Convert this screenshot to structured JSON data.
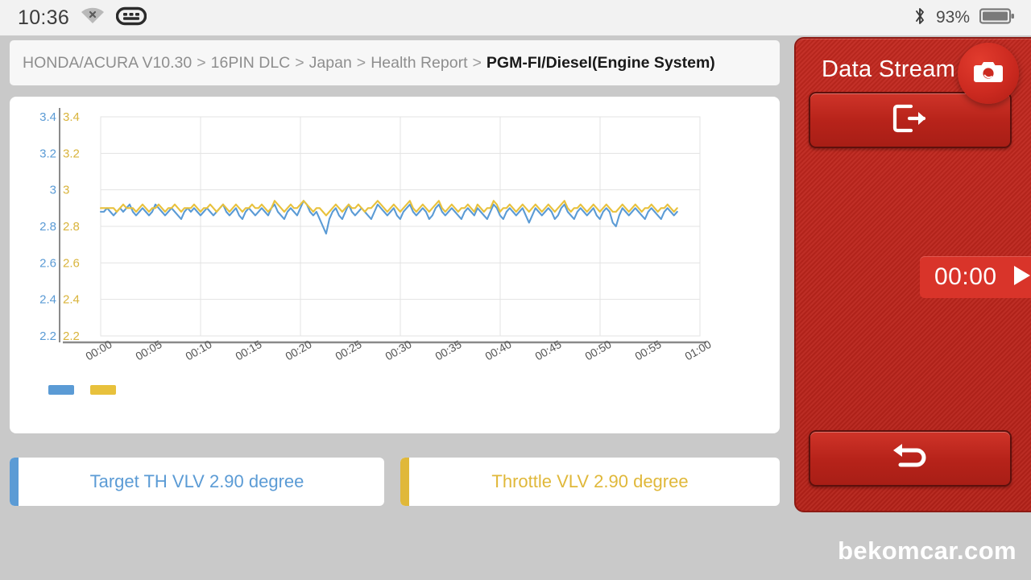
{
  "statusbar": {
    "time": "10:36",
    "battery_percent": "93%",
    "wifi_icon": "wifi-off-icon",
    "keyboard_icon": "keyboard-icon",
    "bluetooth_icon": "bluetooth-icon",
    "battery_icon": "battery-icon"
  },
  "breadcrumb": {
    "items": [
      {
        "label": "HONDA/ACURA V10.30",
        "active": false
      },
      {
        "label": "16PIN DLC",
        "active": false
      },
      {
        "label": "Japan",
        "active": false
      },
      {
        "label": "Health Report",
        "active": false
      },
      {
        "label": "PGM-FI/Diesel(Engine System)",
        "active": true
      }
    ],
    "separator": ">"
  },
  "side_panel": {
    "title": "Data Stream",
    "exit_button_icon": "exit-icon",
    "back_button_icon": "back-arrow-icon",
    "camera_button_icon": "camera-icon",
    "timer": {
      "value": "00:00",
      "play_icon": "play-icon"
    }
  },
  "value_cards": [
    {
      "label": "Target TH VLV 2.90 degree",
      "name": "Target TH VLV",
      "value": "2.90",
      "unit": "degree",
      "color": "#5b9bd5"
    },
    {
      "label": "Throttle VLV 2.90 degree",
      "name": "Throttle VLV",
      "value": "2.90",
      "unit": "degree",
      "color": "#e0b83a"
    }
  ],
  "footer": {
    "watermark": "bekomcar.com"
  },
  "colors": {
    "series_blue": "#5b9bd5",
    "series_gold": "#e8c13c",
    "panel_red": "#b7231a",
    "grid": "#e3e3e3"
  },
  "chart_data": {
    "type": "line",
    "title": "",
    "xlabel": "",
    "ylabel": "",
    "grid": true,
    "legend_position": "bottom-left",
    "legend_labels": [
      "",
      ""
    ],
    "x_tick_labels": [
      "00:00",
      "00:05",
      "00:10",
      "00:15",
      "00:20",
      "00:25",
      "00:30",
      "00:35",
      "00:40",
      "00:45",
      "00:50",
      "00:55",
      "01:00"
    ],
    "x_tick_rotation_deg": -30,
    "xlim": [
      0,
      60
    ],
    "y_axes": [
      {
        "name": "left",
        "color": "#5b9bd5",
        "ticks": [
          2.2,
          2.4,
          2.6,
          2.8,
          3.0,
          3.2,
          3.4
        ],
        "tick_labels": [
          "2.2",
          "2.4",
          "2.6",
          "2.8",
          "3",
          "3.2",
          "3.4"
        ],
        "ylim": [
          2.2,
          3.4
        ]
      },
      {
        "name": "right",
        "color": "#d9b43c",
        "ticks": [
          2.2,
          2.4,
          2.6,
          2.8,
          3.0,
          3.2,
          3.4
        ],
        "tick_labels": [
          "2.2",
          "2.4",
          "2.6",
          "2.8",
          "3",
          "3.2",
          "3.4"
        ],
        "ylim": [
          2.2,
          3.4
        ]
      }
    ],
    "gridline_values": [
      2.2,
      2.4,
      2.6,
      2.8,
      3.0,
      3.2,
      3.4
    ],
    "series": [
      {
        "name": "Target TH VLV",
        "color": "#5b9bd5",
        "axis": "left",
        "values": [
          2.88,
          2.88,
          2.9,
          2.88,
          2.86,
          2.88,
          2.9,
          2.88,
          2.9,
          2.92,
          2.88,
          2.86,
          2.88,
          2.9,
          2.88,
          2.86,
          2.88,
          2.92,
          2.9,
          2.88,
          2.86,
          2.88,
          2.9,
          2.88,
          2.86,
          2.84,
          2.88,
          2.9,
          2.88,
          2.9,
          2.88,
          2.86,
          2.88,
          2.9,
          2.88,
          2.86,
          2.88,
          2.9,
          2.92,
          2.88,
          2.86,
          2.88,
          2.9,
          2.86,
          2.84,
          2.88,
          2.9,
          2.88,
          2.86,
          2.88,
          2.9,
          2.88,
          2.86,
          2.9,
          2.92,
          2.88,
          2.86,
          2.84,
          2.88,
          2.9,
          2.88,
          2.86,
          2.9,
          2.94,
          2.92,
          2.88,
          2.86,
          2.88,
          2.84,
          2.8,
          2.76,
          2.84,
          2.88,
          2.9,
          2.86,
          2.84,
          2.88,
          2.92,
          2.88,
          2.86,
          2.88,
          2.9,
          2.88,
          2.86,
          2.84,
          2.88,
          2.92,
          2.9,
          2.88,
          2.86,
          2.88,
          2.9,
          2.86,
          2.84,
          2.88,
          2.9,
          2.92,
          2.88,
          2.86,
          2.88,
          2.9,
          2.88,
          2.84,
          2.86,
          2.9,
          2.92,
          2.88,
          2.86,
          2.88,
          2.9,
          2.88,
          2.86,
          2.84,
          2.88,
          2.9,
          2.88,
          2.86,
          2.9,
          2.88,
          2.86,
          2.84,
          2.88,
          2.92,
          2.9,
          2.86,
          2.84,
          2.88,
          2.9,
          2.88,
          2.86,
          2.88,
          2.9,
          2.86,
          2.82,
          2.86,
          2.9,
          2.88,
          2.86,
          2.88,
          2.9,
          2.88,
          2.84,
          2.86,
          2.9,
          2.92,
          2.88,
          2.86,
          2.84,
          2.88,
          2.9,
          2.88,
          2.86,
          2.88,
          2.9,
          2.86,
          2.84,
          2.88,
          2.9,
          2.88,
          2.82,
          2.8,
          2.86,
          2.9,
          2.88,
          2.86,
          2.88,
          2.9,
          2.88,
          2.86,
          2.84,
          2.88,
          2.9,
          2.88,
          2.86,
          2.84,
          2.88,
          2.9,
          2.88,
          2.86,
          2.88
        ]
      },
      {
        "name": "Throttle VLV",
        "color": "#e8c13c",
        "axis": "right",
        "values": [
          2.9,
          2.9,
          2.9,
          2.9,
          2.9,
          2.88,
          2.9,
          2.92,
          2.9,
          2.9,
          2.9,
          2.88,
          2.9,
          2.92,
          2.9,
          2.88,
          2.9,
          2.9,
          2.92,
          2.9,
          2.88,
          2.9,
          2.9,
          2.92,
          2.9,
          2.88,
          2.9,
          2.9,
          2.9,
          2.92,
          2.9,
          2.88,
          2.9,
          2.9,
          2.92,
          2.9,
          2.88,
          2.9,
          2.92,
          2.9,
          2.88,
          2.9,
          2.92,
          2.9,
          2.88,
          2.9,
          2.9,
          2.92,
          2.9,
          2.9,
          2.92,
          2.9,
          2.88,
          2.9,
          2.94,
          2.92,
          2.9,
          2.88,
          2.9,
          2.92,
          2.9,
          2.9,
          2.92,
          2.94,
          2.92,
          2.9,
          2.88,
          2.9,
          2.9,
          2.88,
          2.86,
          2.88,
          2.9,
          2.92,
          2.9,
          2.88,
          2.9,
          2.92,
          2.9,
          2.9,
          2.92,
          2.9,
          2.88,
          2.9,
          2.9,
          2.92,
          2.94,
          2.92,
          2.9,
          2.88,
          2.9,
          2.92,
          2.9,
          2.88,
          2.9,
          2.92,
          2.94,
          2.9,
          2.88,
          2.9,
          2.92,
          2.9,
          2.88,
          2.9,
          2.92,
          2.94,
          2.9,
          2.88,
          2.9,
          2.92,
          2.9,
          2.88,
          2.9,
          2.9,
          2.92,
          2.9,
          2.88,
          2.92,
          2.9,
          2.88,
          2.9,
          2.9,
          2.94,
          2.92,
          2.88,
          2.9,
          2.9,
          2.92,
          2.9,
          2.88,
          2.9,
          2.92,
          2.9,
          2.88,
          2.9,
          2.92,
          2.9,
          2.88,
          2.9,
          2.92,
          2.9,
          2.88,
          2.9,
          2.92,
          2.94,
          2.9,
          2.88,
          2.9,
          2.9,
          2.92,
          2.9,
          2.88,
          2.9,
          2.92,
          2.9,
          2.88,
          2.9,
          2.92,
          2.9,
          2.88,
          2.88,
          2.9,
          2.92,
          2.9,
          2.88,
          2.9,
          2.92,
          2.9,
          2.88,
          2.9,
          2.9,
          2.92,
          2.9,
          2.88,
          2.9,
          2.9,
          2.92,
          2.9,
          2.88,
          2.9
        ]
      }
    ]
  }
}
